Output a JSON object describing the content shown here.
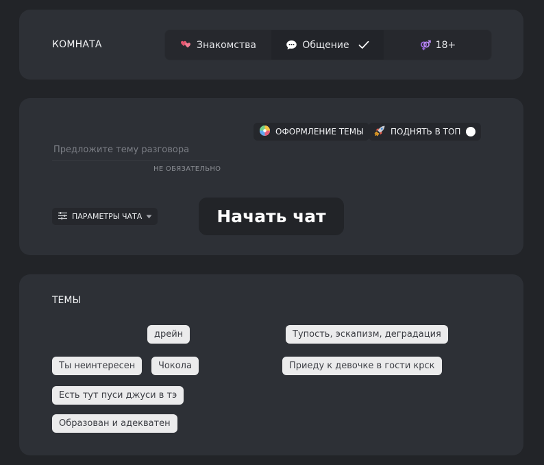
{
  "room": {
    "title": "КОМНАТА",
    "options": [
      {
        "label": "Знакомства",
        "icon": "hearts-icon",
        "selected": false
      },
      {
        "label": "Общение",
        "icon": "speech-bubble-icon",
        "selected": true
      },
      {
        "label": "18+",
        "icon": "gender-icon",
        "selected": false
      }
    ]
  },
  "start": {
    "topic_placeholder": "Предложите тему разговора",
    "topic_value": "",
    "optional_label": "НЕ ОБЯЗАТЕЛЬНО",
    "theme_button": "ОФОРМЛЕНИЕ ТЕМЫ",
    "boost_button": "ПОДНЯТЬ В ТОП",
    "boost_enabled": false,
    "params_button": "ПАРАМЕТРЫ ЧАТА",
    "start_button": "Начать чат"
  },
  "topics": {
    "title": "ТЕМЫ",
    "tags": [
      "дрейн",
      "Тупость, эскапизм, деградация",
      "Ты неинтересен",
      "Чокола",
      "Приеду к девочке в гости крск",
      "Есть тут пуси джуси в тэ",
      "Образован и адекватен"
    ]
  },
  "colors": {
    "background": "#222428",
    "card": "#2d3036",
    "tag_bg": "#ebebec",
    "tag_text": "#3c3e44",
    "accent_pink": "#e4556e",
    "accent_purple": "#a06be0"
  }
}
